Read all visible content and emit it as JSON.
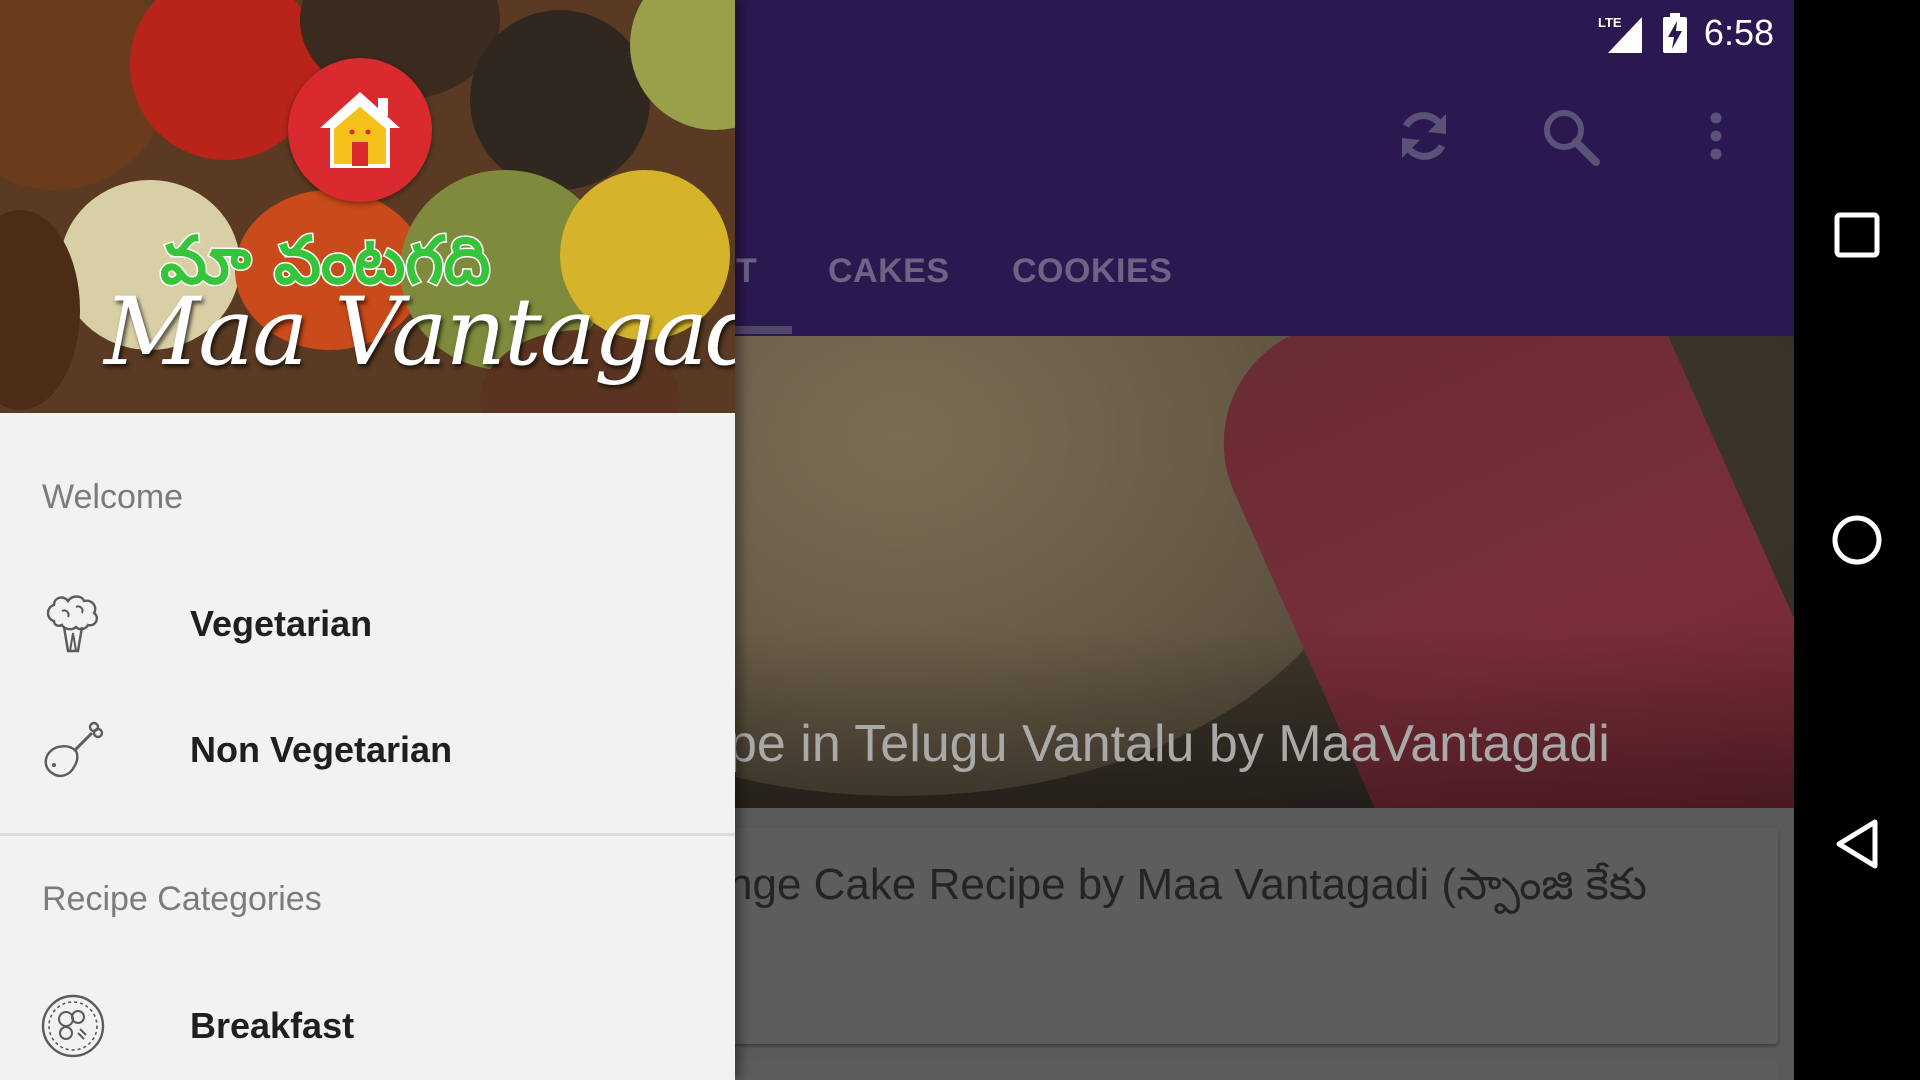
{
  "status_bar": {
    "time": "6:58",
    "network_label": "LTE",
    "icons": [
      "lte-signal-icon",
      "battery-charging-icon"
    ]
  },
  "toolbar": {
    "actions": [
      "refresh-icon",
      "search-icon",
      "more-vert-icon"
    ]
  },
  "tabs": [
    {
      "label": "T"
    },
    {
      "label": "CAKES"
    },
    {
      "label": "COOKIES"
    }
  ],
  "hero": {
    "title": "pe in Telugu Vantalu by MaaVantagadi"
  },
  "card": {
    "title": "nge Cake Recipe by Maa Vantagadi (స్పాంజి కేకు"
  },
  "drawer": {
    "header": {
      "logo_telugu": "మా వంటగది",
      "logo_english": "Maa Vantagadi",
      "logo_icon": "home-icon"
    },
    "sections": [
      {
        "title": "Welcome",
        "items": [
          {
            "label": "Vegetarian",
            "icon": "broccoli-icon"
          },
          {
            "label": "Non Vegetarian",
            "icon": "drumstick-icon"
          }
        ]
      },
      {
        "title": "Recipe Categories",
        "items": [
          {
            "label": "Breakfast",
            "icon": "plate-icon"
          }
        ]
      }
    ]
  },
  "nav_bar": {
    "buttons": [
      "recents-icon",
      "home-circle-icon",
      "back-icon"
    ]
  },
  "colors": {
    "app_bar": "#2c1850",
    "drawer_bg": "#f2f2f2",
    "logo_red": "#d82a2f",
    "logo_green": "#35c43a"
  }
}
